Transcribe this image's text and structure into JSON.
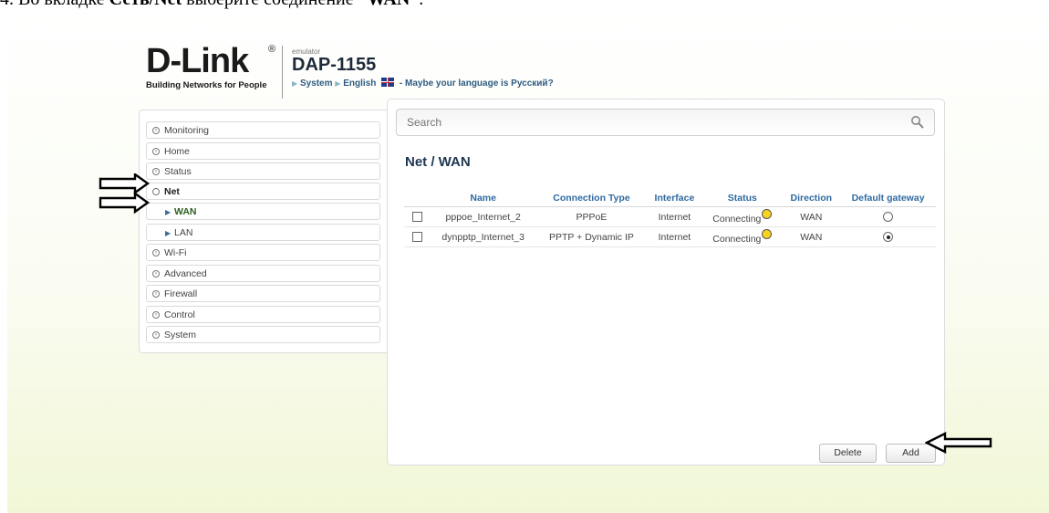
{
  "instruction": {
    "prefix": "4.  Во вкладке ",
    "bold": "Сеть/Net",
    "middle": " выберите соединение ",
    "quoted": "“WAN”",
    "suffix": "."
  },
  "header": {
    "logo": "D-Link",
    "registered": "®",
    "tagline": "Building Networks for People",
    "emulator": "emulator",
    "model": "DAP-1155",
    "crumb_system": "System",
    "crumb_language": "English",
    "language_hint": "- Maybe your language is Русский?"
  },
  "sidebar": {
    "items": [
      {
        "label": "Monitoring"
      },
      {
        "label": "Home"
      },
      {
        "label": "Status"
      },
      {
        "label": "Net"
      },
      {
        "label": "WAN"
      },
      {
        "label": "LAN"
      },
      {
        "label": "Wi-Fi"
      },
      {
        "label": "Advanced"
      },
      {
        "label": "Firewall"
      },
      {
        "label": "Control"
      },
      {
        "label": "System"
      }
    ]
  },
  "search": {
    "placeholder": "Search"
  },
  "page_title": "Net /  WAN",
  "table": {
    "headers": [
      "Name",
      "Connection Type",
      "Interface",
      "Status",
      "Direction",
      "Default gateway"
    ],
    "rows": [
      {
        "name": "pppoe_Internet_2",
        "type": "PPPoE",
        "interface": "Internet",
        "status": "Connecting",
        "direction": "WAN",
        "default_gateway": false
      },
      {
        "name": "dynpptp_Internet_3",
        "type": "PPTP + Dynamic IP",
        "interface": "Internet",
        "status": "Connecting",
        "direction": "WAN",
        "default_gateway": true
      }
    ]
  },
  "buttons": {
    "delete": "Delete",
    "add": "Add"
  },
  "colors": {
    "title": "#1f3650",
    "header_text": "#2f6aa0",
    "status_dot": "#f7d21e",
    "bg_bottom": "#f1f7d6"
  }
}
